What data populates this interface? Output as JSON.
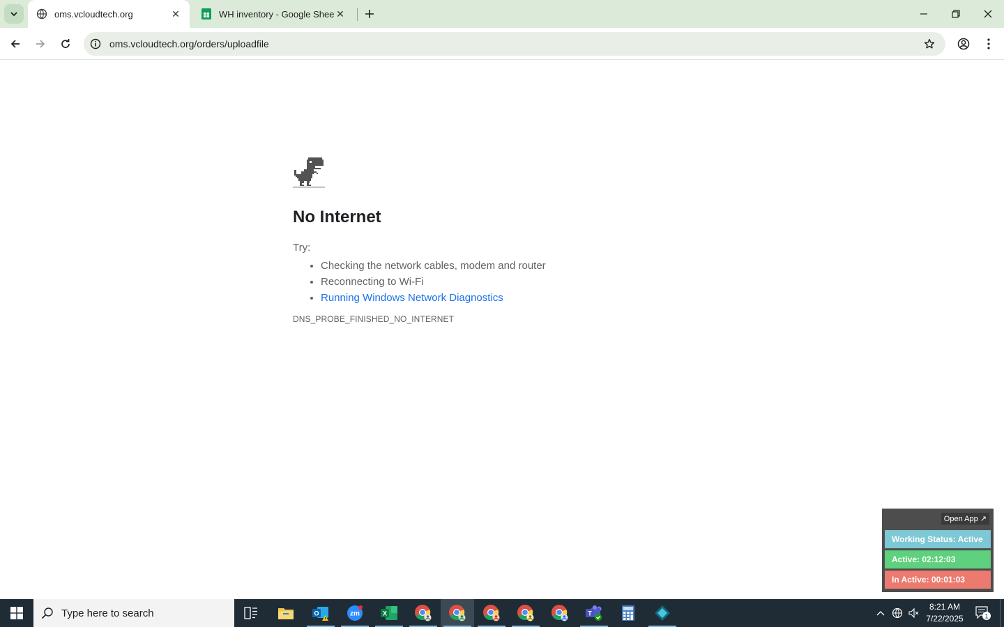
{
  "browser": {
    "tabs": [
      {
        "title": "oms.vcloudtech.org",
        "active": true,
        "icon": "globe-icon"
      },
      {
        "title": "WH inventory - Google Sheets",
        "active": false,
        "icon": "google-sheets-icon"
      }
    ],
    "url": "oms.vcloudtech.org/orders/uploadfile"
  },
  "error": {
    "title": "No Internet",
    "try_label": "Try:",
    "suggestions": [
      "Checking the network cables, modem and router",
      "Reconnecting to Wi-Fi"
    ],
    "diagnostics_link": "Running Windows Network Diagnostics",
    "code": "DNS_PROBE_FINISHED_NO_INTERNET"
  },
  "tracker": {
    "open_app": "Open App ↗",
    "status": "Working Status: Active",
    "active": "Active: 02:12:03",
    "inactive": "In Active: 00:01:03",
    "colors": {
      "status": "#7ec8d6",
      "active": "#5fd07e",
      "inactive": "#ec7a6f"
    }
  },
  "taskbar": {
    "search_placeholder": "Type here to search",
    "apps": [
      "task-view",
      "file-explorer",
      "outlook",
      "zoom",
      "excel",
      "chrome",
      "chrome",
      "chrome",
      "chrome",
      "chrome",
      "teams",
      "calculator",
      "app"
    ],
    "zoom_label": "zm",
    "excel_label": "X",
    "teams_label": "T",
    "time": "8:21 AM",
    "date": "7/22/2025",
    "notification_count": "1"
  }
}
